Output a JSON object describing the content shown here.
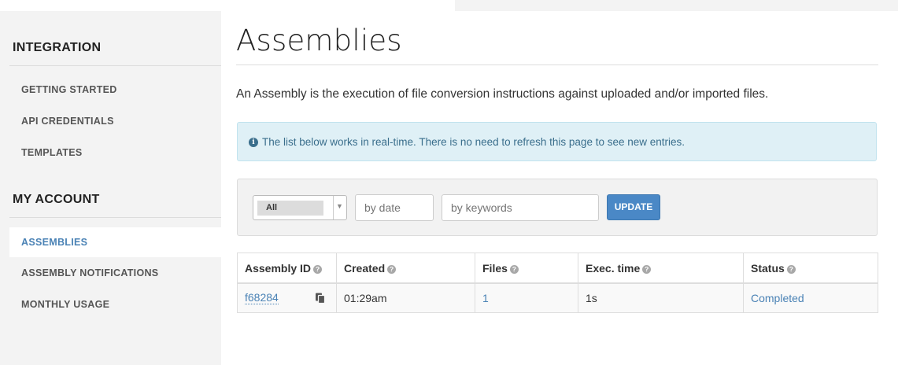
{
  "sidebar": {
    "sections": [
      {
        "heading": "INTEGRATION",
        "items": [
          "GETTING STARTED",
          "API CREDENTIALS",
          "TEMPLATES"
        ]
      },
      {
        "heading": "MY ACCOUNT",
        "items": [
          "ASSEMBLIES",
          "ASSEMBLY NOTIFICATIONS",
          "MONTHLY USAGE"
        ]
      }
    ],
    "active_item": "ASSEMBLIES"
  },
  "main": {
    "title": "Assemblies",
    "description": "An Assembly is the execution of file conversion instructions against uploaded and/or imported files.",
    "alert": {
      "icon": "info-icon",
      "icon_glyph": "i",
      "text": "The list below works in real-time. There is no need to refresh this page to see new entries."
    },
    "filter": {
      "select_value": "All",
      "date_placeholder": "by date",
      "keywords_placeholder": "by keywords",
      "update_label": "UPDATE"
    },
    "table": {
      "columns": [
        "Assembly ID",
        "Created",
        "Files",
        "Exec. time",
        "Status"
      ],
      "help_glyph": "?",
      "rows": [
        {
          "id": "f68284",
          "created": "01:29am",
          "files": "1",
          "exec_time": "1s",
          "status": "Completed"
        }
      ]
    }
  },
  "colors": {
    "accent": "#4a82b5",
    "button": "#4a88c6",
    "alert_bg": "#dff0f6",
    "alert_text": "#3a6e8c"
  }
}
